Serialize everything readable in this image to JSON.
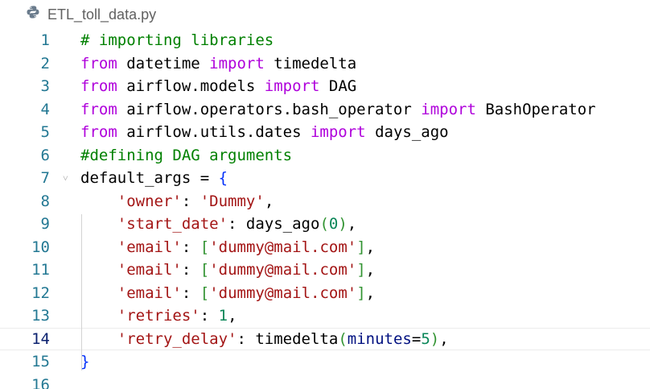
{
  "tab": {
    "filename": "ETL_toll_data.py",
    "icon": "python-icon"
  },
  "colors": {
    "comment": "#008000",
    "keyword": "#af00db",
    "string": "#a31515",
    "number": "#098658",
    "brace": "#0431fa",
    "paren": "#319331",
    "line_number": "#237893"
  },
  "editor": {
    "current_line": 14,
    "lines": [
      {
        "n": "1",
        "tokens": [
          [
            "comment",
            "# importing libraries"
          ]
        ]
      },
      {
        "n": "2",
        "tokens": [
          [
            "keyword",
            "from"
          ],
          [
            "plain",
            " datetime "
          ],
          [
            "keyword",
            "import"
          ],
          [
            "plain",
            " timedelta"
          ]
        ]
      },
      {
        "n": "3",
        "tokens": [
          [
            "keyword",
            "from"
          ],
          [
            "plain",
            " airflow.models "
          ],
          [
            "keyword",
            "import"
          ],
          [
            "plain",
            " DAG"
          ]
        ]
      },
      {
        "n": "4",
        "tokens": [
          [
            "keyword",
            "from"
          ],
          [
            "plain",
            " airflow.operators.bash_operator "
          ],
          [
            "keyword",
            "import"
          ],
          [
            "plain",
            " BashOperator"
          ]
        ]
      },
      {
        "n": "5",
        "tokens": [
          [
            "keyword",
            "from"
          ],
          [
            "plain",
            " airflow.utils.dates "
          ],
          [
            "keyword",
            "import"
          ],
          [
            "plain",
            " days_ago"
          ]
        ]
      },
      {
        "n": "6",
        "tokens": [
          [
            "comment",
            "#defining DAG arguments"
          ]
        ]
      },
      {
        "n": "7",
        "fold": true,
        "tokens": [
          [
            "plain",
            "default_args = "
          ],
          [
            "brace",
            "{"
          ]
        ]
      },
      {
        "n": "8",
        "tokens": [
          [
            "plain",
            "    "
          ],
          [
            "string",
            "'owner'"
          ],
          [
            "plain",
            ": "
          ],
          [
            "string",
            "'Dummy'"
          ],
          [
            "plain",
            ","
          ]
        ]
      },
      {
        "n": "9",
        "tokens": [
          [
            "plain",
            "    "
          ],
          [
            "string",
            "'start_date'"
          ],
          [
            "plain",
            ": days_ago"
          ],
          [
            "paren",
            "("
          ],
          [
            "number",
            "0"
          ],
          [
            "paren",
            ")"
          ],
          [
            "plain",
            ","
          ]
        ]
      },
      {
        "n": "10",
        "tokens": [
          [
            "plain",
            "    "
          ],
          [
            "string",
            "'email'"
          ],
          [
            "plain",
            ": "
          ],
          [
            "paren",
            "["
          ],
          [
            "string",
            "'dummy@mail.com'"
          ],
          [
            "paren",
            "]"
          ],
          [
            "plain",
            ","
          ]
        ]
      },
      {
        "n": "11",
        "tokens": [
          [
            "plain",
            "    "
          ],
          [
            "string",
            "'email'"
          ],
          [
            "plain",
            ": "
          ],
          [
            "paren",
            "["
          ],
          [
            "string",
            "'dummy@mail.com'"
          ],
          [
            "paren",
            "]"
          ],
          [
            "plain",
            ","
          ]
        ]
      },
      {
        "n": "12",
        "tokens": [
          [
            "plain",
            "    "
          ],
          [
            "string",
            "'email'"
          ],
          [
            "plain",
            ": "
          ],
          [
            "paren",
            "["
          ],
          [
            "string",
            "'dummy@mail.com'"
          ],
          [
            "paren",
            "]"
          ],
          [
            "plain",
            ","
          ]
        ]
      },
      {
        "n": "13",
        "tokens": [
          [
            "plain",
            "    "
          ],
          [
            "string",
            "'retries'"
          ],
          [
            "plain",
            ": "
          ],
          [
            "number",
            "1"
          ],
          [
            "plain",
            ","
          ]
        ]
      },
      {
        "n": "14",
        "tokens": [
          [
            "plain",
            "    "
          ],
          [
            "string",
            "'retry_delay'"
          ],
          [
            "plain",
            ": timedelta"
          ],
          [
            "paren",
            "("
          ],
          [
            "param",
            "minutes"
          ],
          [
            "plain",
            "="
          ],
          [
            "number",
            "5"
          ],
          [
            "paren",
            ")"
          ],
          [
            "plain",
            ","
          ]
        ]
      },
      {
        "n": "15",
        "tokens": [
          [
            "brace",
            "}"
          ]
        ]
      },
      {
        "n": "16",
        "tokens": []
      }
    ]
  }
}
